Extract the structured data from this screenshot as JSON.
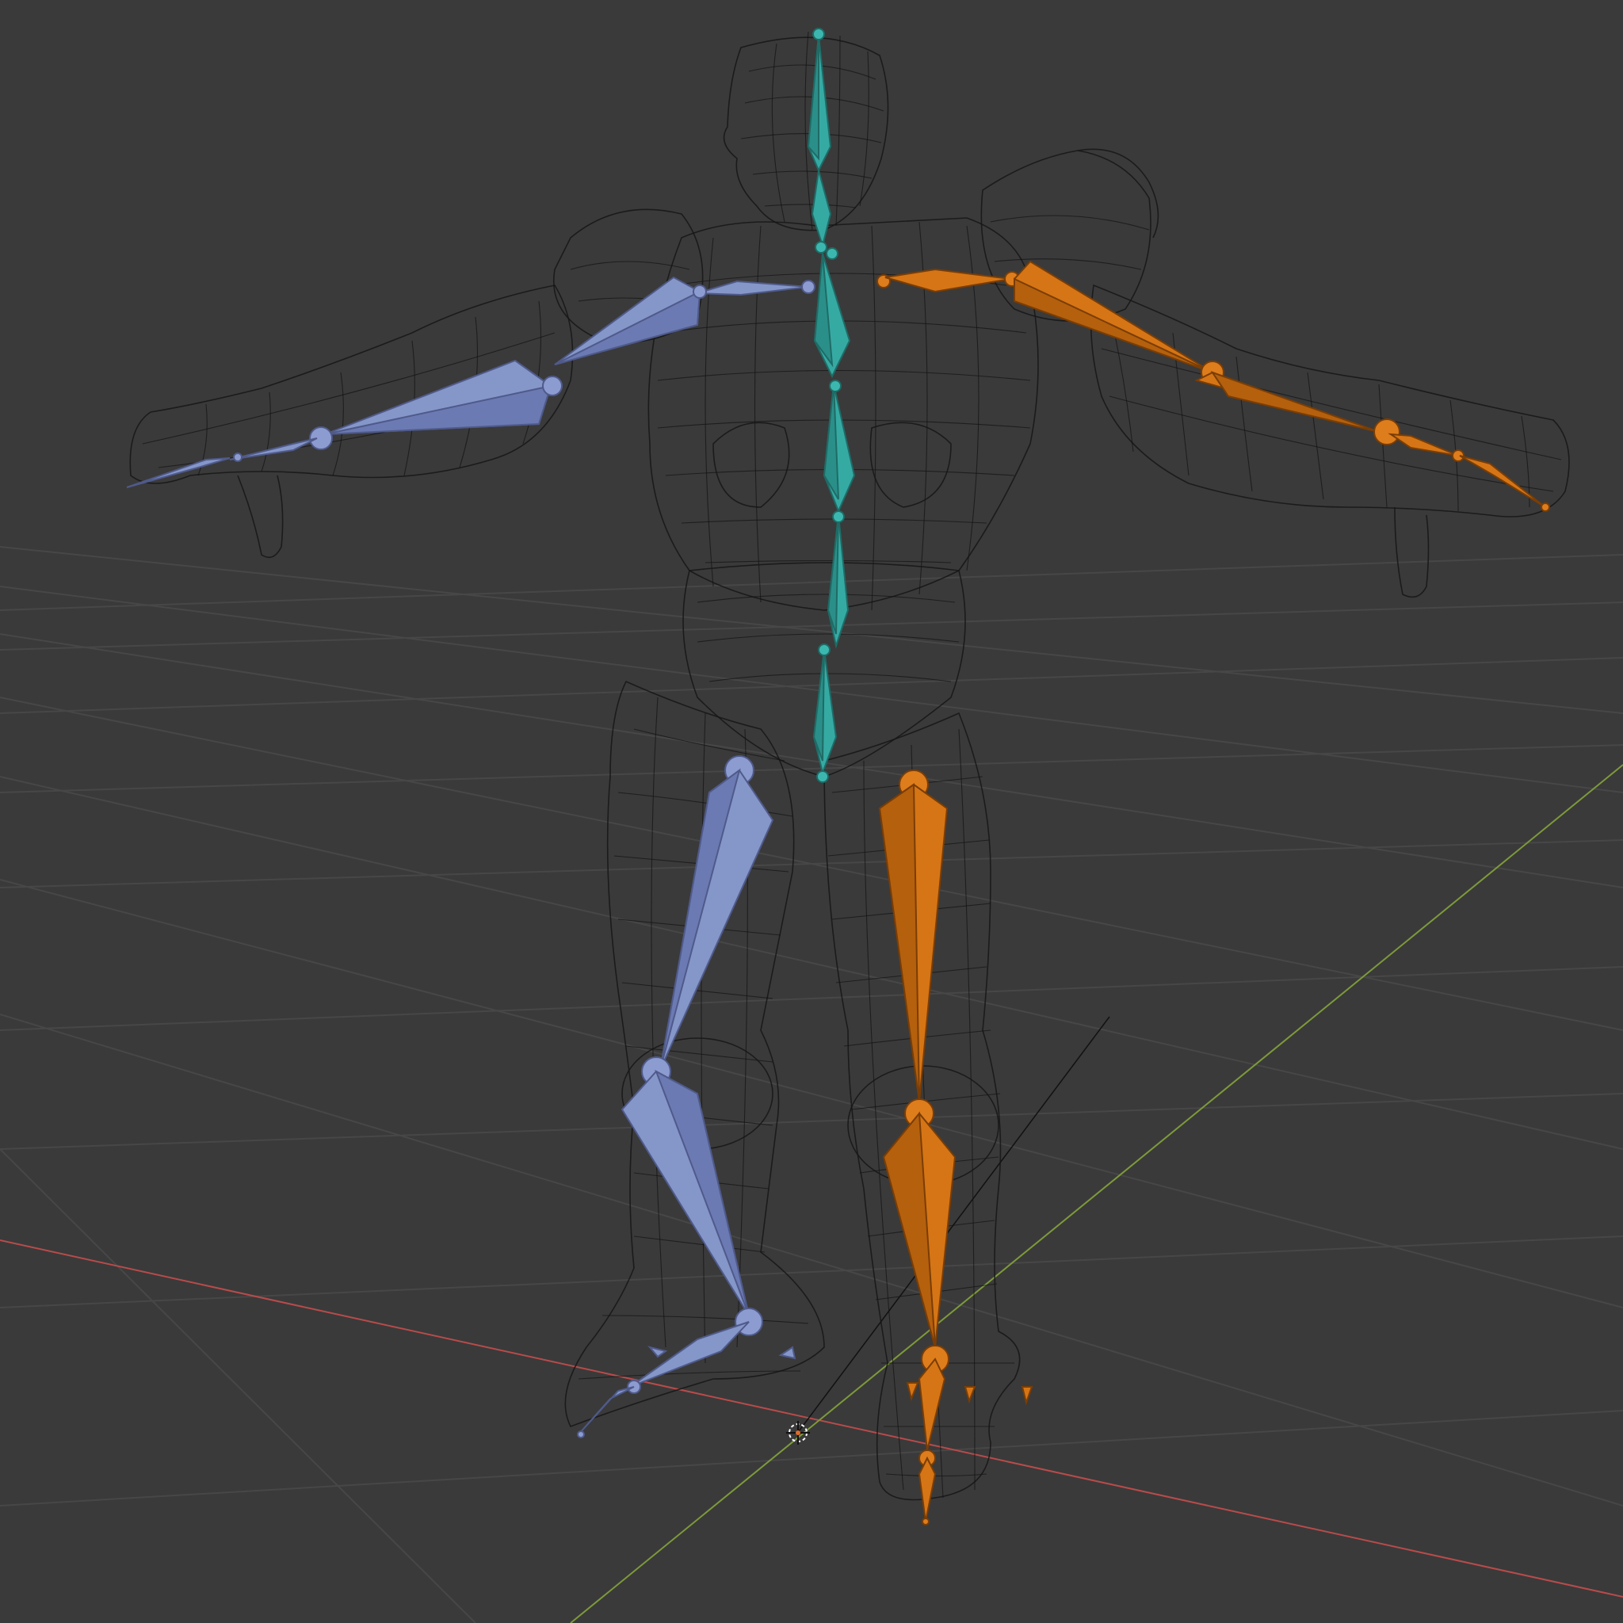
{
  "viewport": {
    "background": "#3a3a3a",
    "grid_color": "#474747",
    "x_axis_color": "#b84b4b",
    "y_axis_color": "#7d9a3a"
  },
  "armature": {
    "colors": {
      "spine": "#35aaa3",
      "left_limbs": "#8596c9",
      "right_limbs": "#d67515",
      "mesh_wire": "#161616"
    }
  },
  "widgets": {
    "origin_cursor": "3d-cursor-icon"
  }
}
